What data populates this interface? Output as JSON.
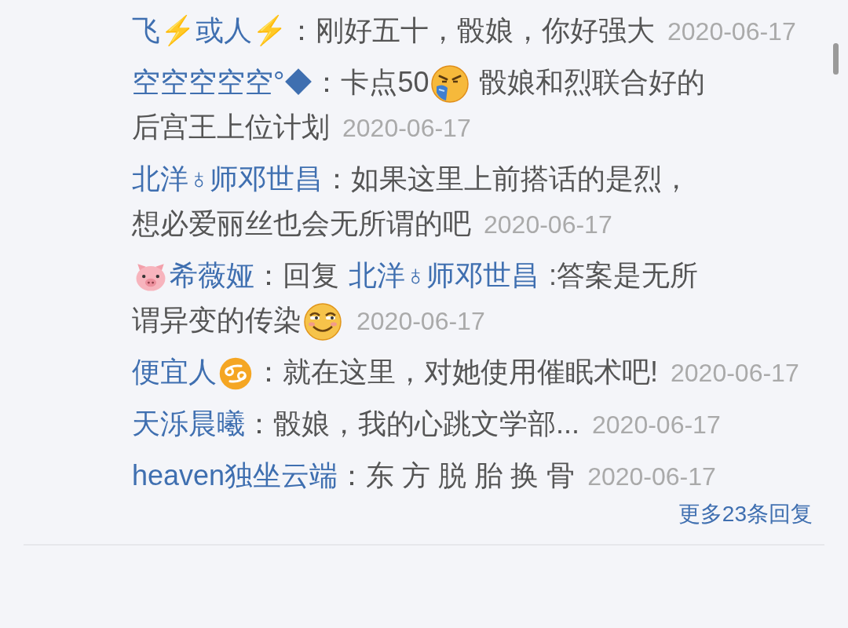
{
  "comments": [
    {
      "name_parts": [
        {
          "kind": "name",
          "text": "飞⚡或人⚡"
        }
      ],
      "parts": [
        {
          "kind": "text",
          "text": "：刚好五十，骰娘，你好强大"
        }
      ],
      "date": "2020-06-17"
    },
    {
      "name_parts": [
        {
          "kind": "name",
          "text": "空空空空空°◆"
        }
      ],
      "parts": [
        {
          "kind": "text",
          "text": "：卡点50"
        },
        {
          "kind": "drool"
        },
        {
          "kind": "text",
          "text": " 骰娘和烈联合好的"
        },
        {
          "kind": "text",
          "text": "后宫王上位计划"
        }
      ],
      "date": "2020-06-17"
    },
    {
      "name_parts": [
        {
          "kind": "name",
          "text": "北洋♁师邓世昌"
        }
      ],
      "parts": [
        {
          "kind": "text",
          "text": "：如果这里上前搭话的是烈，"
        },
        {
          "kind": "text",
          "text": "想必爱丽丝也会无所谓的吧"
        }
      ],
      "date": "2020-06-17"
    },
    {
      "name_parts": [
        {
          "kind": "pig"
        },
        {
          "kind": "name",
          "text": "希薇娅"
        }
      ],
      "parts": [
        {
          "kind": "text",
          "text": "：回复 "
        },
        {
          "kind": "mention",
          "text": "北洋♁师邓世昌"
        },
        {
          "kind": "text",
          "text": " :答案是无所"
        },
        {
          "kind": "text",
          "text": "谓异变的传染"
        },
        {
          "kind": "smirk"
        }
      ],
      "date": "2020-06-17"
    },
    {
      "name_parts": [
        {
          "kind": "name",
          "text": "便宜人"
        },
        {
          "kind": "cancer"
        }
      ],
      "parts": [
        {
          "kind": "text",
          "text": "：就在这里，对她使用催眠术吧!"
        }
      ],
      "date": "2020-06-17"
    },
    {
      "name_parts": [
        {
          "kind": "name",
          "text": "天泺晨曦"
        }
      ],
      "parts": [
        {
          "kind": "text",
          "text": "：骰娘，我的心跳文学部..."
        }
      ],
      "date": "2020-06-17"
    },
    {
      "name_parts": [
        {
          "kind": "name",
          "text": "heaven独坐云端"
        }
      ],
      "parts": [
        {
          "kind": "text",
          "text": "：东 方 脱 胎 换 骨"
        }
      ],
      "date": "2020-06-17"
    }
  ],
  "more_replies": "更多23条回复"
}
